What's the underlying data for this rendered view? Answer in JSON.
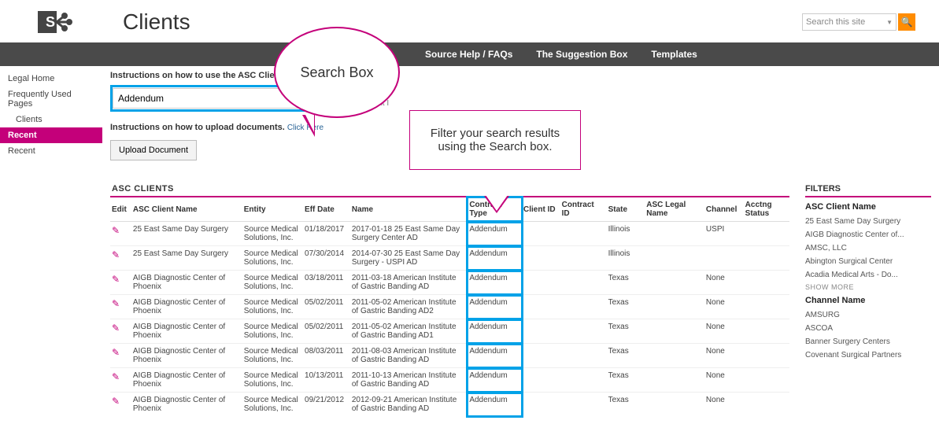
{
  "header": {
    "page_title": "Clients",
    "site_search_placeholder": "Search this site"
  },
  "nav": {
    "items": [
      "Source Help / FAQs",
      "The Suggestion Box",
      "Templates"
    ]
  },
  "leftnav": {
    "items": [
      {
        "label": "Legal Home",
        "active": false
      },
      {
        "label": "Frequently Used Pages",
        "active": false
      },
      {
        "label": "Clients",
        "active": false,
        "indent": true
      },
      {
        "label": "Recent",
        "active": true
      },
      {
        "label": "Recent",
        "active": false
      }
    ]
  },
  "instructions_search": "Instructions on how to use the ASC Clients search page",
  "instructions_upload": "Instructions on how to upload documents.",
  "click_here": "Click Here",
  "search": {
    "value": "Addendum",
    "checkbox_label": "Client I"
  },
  "upload_button": "Upload Document",
  "annotation_bubble": "Search Box",
  "annotation_callout": "Filter your search results using the Search box.",
  "table": {
    "title": "ASC CLIENTS",
    "columns": [
      "Edit",
      "ASC Client Name",
      "Entity",
      "Eff Date",
      "Name",
      "Contract Type",
      "Client ID",
      "Contract ID",
      "State",
      "ASC Legal Name",
      "Channel",
      "Acctng Status"
    ],
    "rows": [
      {
        "client": "25 East Same Day Surgery",
        "entity": "Source Medical Solutions, Inc.",
        "eff": "01/18/2017",
        "name": "2017-01-18 25 East Same Day Surgery Center AD",
        "ctype": "Addendum",
        "cid": "",
        "conid": "",
        "state": "Illinois",
        "legal": "",
        "channel": "USPI",
        "acct": ""
      },
      {
        "client": "25 East Same Day Surgery",
        "entity": "Source Medical Solutions, Inc.",
        "eff": "07/30/2014",
        "name": "2014-07-30 25 East Same Day Surgery - USPI AD",
        "ctype": "Addendum",
        "cid": "",
        "conid": "",
        "state": "Illinois",
        "legal": "",
        "channel": "",
        "acct": ""
      },
      {
        "client": "AIGB Diagnostic Center of Phoenix",
        "entity": "Source Medical Solutions, Inc.",
        "eff": "03/18/2011",
        "name": "2011-03-18 American Institute of Gastric Banding AD",
        "ctype": "Addendum",
        "cid": "",
        "conid": "",
        "state": "Texas",
        "legal": "",
        "channel": "None",
        "acct": ""
      },
      {
        "client": "AIGB Diagnostic Center of Phoenix",
        "entity": "Source Medical Solutions, Inc.",
        "eff": "05/02/2011",
        "name": "2011-05-02 American Institute of Gastric Banding AD2",
        "ctype": "Addendum",
        "cid": "",
        "conid": "",
        "state": "Texas",
        "legal": "",
        "channel": "None",
        "acct": ""
      },
      {
        "client": "AIGB Diagnostic Center of Phoenix",
        "entity": "Source Medical Solutions, Inc.",
        "eff": "05/02/2011",
        "name": "2011-05-02 American Institute of Gastric Banding AD1",
        "ctype": "Addendum",
        "cid": "",
        "conid": "",
        "state": "Texas",
        "legal": "",
        "channel": "None",
        "acct": ""
      },
      {
        "client": "AIGB Diagnostic Center of Phoenix",
        "entity": "Source Medical Solutions, Inc.",
        "eff": "08/03/2011",
        "name": "2011-08-03 American Institute of Gastric Banding AD",
        "ctype": "Addendum",
        "cid": "",
        "conid": "",
        "state": "Texas",
        "legal": "",
        "channel": "None",
        "acct": ""
      },
      {
        "client": "AIGB Diagnostic Center of Phoenix",
        "entity": "Source Medical Solutions, Inc.",
        "eff": "10/13/2011",
        "name": "2011-10-13 American Institute of Gastric Banding AD",
        "ctype": "Addendum",
        "cid": "",
        "conid": "",
        "state": "Texas",
        "legal": "",
        "channel": "None",
        "acct": ""
      },
      {
        "client": "AIGB Diagnostic Center of Phoenix",
        "entity": "Source Medical Solutions, Inc.",
        "eff": "09/21/2012",
        "name": "2012-09-21 American Institute of Gastric Banding AD",
        "ctype": "Addendum",
        "cid": "",
        "conid": "",
        "state": "Texas",
        "legal": "",
        "channel": "None",
        "acct": ""
      }
    ]
  },
  "filters": {
    "title": "FILTERS",
    "groups": [
      {
        "name": "ASC Client Name",
        "items": [
          "25 East Same Day Surgery",
          "AIGB Diagnostic Center of...",
          "AMSC, LLC",
          "Abington Surgical Center",
          "Acadia Medical Arts - Do..."
        ],
        "show_more": "SHOW MORE"
      },
      {
        "name": "Channel Name",
        "items": [
          "AMSURG",
          "ASCOA",
          "Banner Surgery Centers",
          "Covenant Surgical Partners"
        ]
      }
    ]
  }
}
